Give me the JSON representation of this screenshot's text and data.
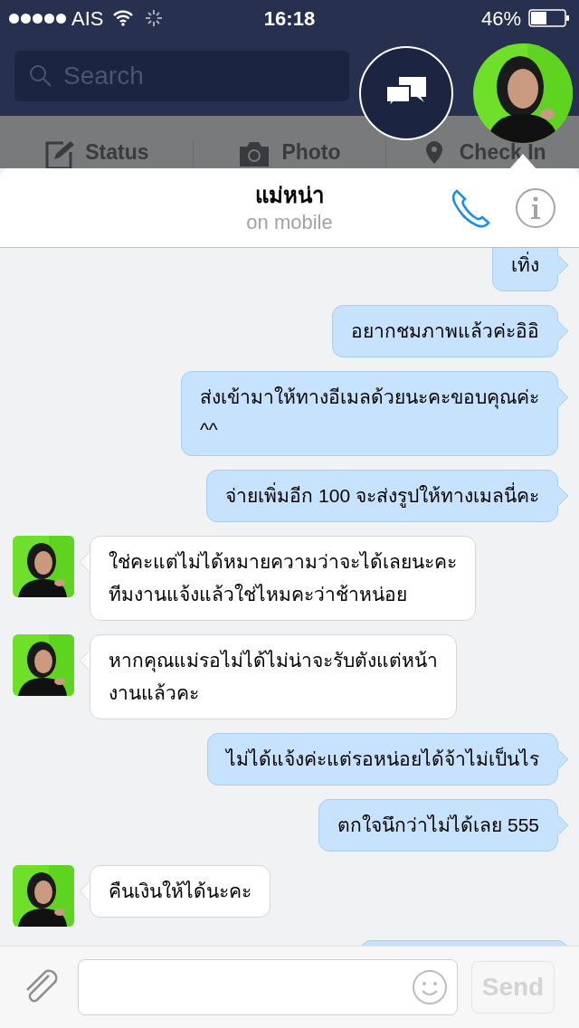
{
  "status_bar": {
    "carrier": "AIS",
    "time": "16:18",
    "battery": "46%"
  },
  "background": {
    "search_placeholder": "Search",
    "actions": [
      {
        "label": "Status",
        "kind": "status"
      },
      {
        "label": "Photo"
      },
      {
        "label": "Check In",
        "kind": "checkin"
      }
    ]
  },
  "chat": {
    "title": "แม่หน่า",
    "subtitle": "on mobile"
  },
  "messages": [
    {
      "outgoing": true,
      "text": "เทิ่ง"
    },
    {
      "outgoing": true,
      "text": "อยากชมภาพแล้วค่ะอิอิ"
    },
    {
      "outgoing": true,
      "text": "ส่งเข้ามาให้ทางอีเมลด้วยนะคะขอบคุณค่ะ\n^^"
    },
    {
      "outgoing": true,
      "text": "จ่ายเพิ่มอีก 100 จะส่งรูปให้ทางเมลนี่คะ"
    },
    {
      "outgoing": false,
      "text": "ใช่คะแต่ไม่ได้หมายความว่าจะได้เลยนะคะ\nทีมงานแจ้งแล้วใช่ไหมคะว่าช้าหน่อย"
    },
    {
      "outgoing": false,
      "text": "หากคุณแม่รอไม่ได้ไม่น่าจะรับตังแต่หน้า\nงานแล้วคะ"
    },
    {
      "outgoing": true,
      "text": "ไม่ได้แจ้งค่ะแต่รอหน่อยได้จ้าไม่เป็นไร"
    },
    {
      "outgoing": true,
      "text": "ตกใจนึกว่าไม่ได้เลย 555"
    },
    {
      "outgoing": false,
      "text": "คืนเงินให้ได้นะคะ"
    },
    {
      "outgoing": true
    }
  ],
  "composer": {
    "send": "Send",
    "send_disabled": true
  }
}
